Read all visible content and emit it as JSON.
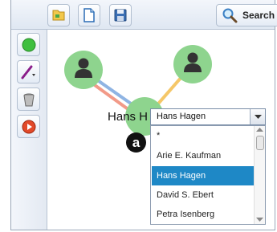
{
  "toolbar": {
    "search_label": "Search",
    "buttons": [
      "open-icon",
      "new-document-icon",
      "save-icon"
    ]
  },
  "sidebar": {
    "tools": [
      "green-circle-icon",
      "line-tool-icon",
      "trash-icon",
      "record-icon"
    ]
  },
  "graph": {
    "node_label": "Hans H",
    "edge_colors": [
      "#8fb4e3",
      "#f29a88",
      "#f5c768"
    ],
    "node_color": "#8ed48e"
  },
  "combo": {
    "value": "Hans Hagen",
    "options": [
      "*",
      "Arie E. Kaufman",
      "Hans Hagen",
      "David S. Ebert",
      "Petra Isenberg"
    ],
    "selected_index": 2
  },
  "annotation": {
    "badge": "a"
  }
}
